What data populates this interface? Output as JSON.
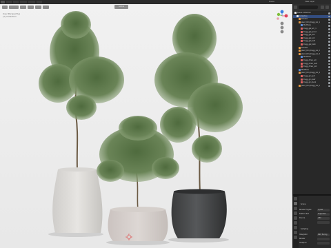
{
  "menu": {
    "items": [
      "",
      "",
      "",
      "",
      "",
      ""
    ]
  },
  "topbar": {
    "scene_label": "Scene",
    "view_layer_label": "View Layer"
  },
  "viewport": {
    "header": {
      "orientation_label": "Global"
    },
    "info_lines": [
      "User Perspective",
      "(1) Collection"
    ]
  },
  "outliner": {
    "rows": [
      {
        "label": "Scene Collection",
        "indent": 0,
        "icon": "collection-icon",
        "selected": false
      },
      {
        "label": "Collection",
        "indent": 1,
        "icon": "collection-icon",
        "selected": true
      },
      {
        "label": "Pot.001",
        "indent": 2,
        "icon": "mesh-icon",
        "selected": false
      },
      {
        "label": "plant_001_Dugg_sm_1",
        "indent": 2,
        "icon": "mesh-icon",
        "selected": false
      },
      {
        "label": "Modifiers",
        "indent": 3,
        "icon": "wrench-icon",
        "selected": false
      },
      {
        "label": "Dugg_gal_sm_1",
        "indent": 3,
        "icon": "material-icon",
        "selected": false
      },
      {
        "label": "Dugg_gal_wood",
        "indent": 3,
        "icon": "material-icon",
        "selected": false
      },
      {
        "label": "Dugg_gal_soil",
        "indent": 3,
        "icon": "material-icon",
        "selected": false
      },
      {
        "label": "Dugg_gal_pot",
        "indent": 3,
        "icon": "material-icon",
        "selected": false
      },
      {
        "label": "Dugg_gal_leaf",
        "indent": 3,
        "icon": "material-icon",
        "selected": false
      },
      {
        "label": "Dugg_gal_bark",
        "indent": 3,
        "icon": "material-icon",
        "selected": false
      },
      {
        "label": "Pot.002",
        "indent": 2,
        "icon": "mesh-icon",
        "selected": false
      },
      {
        "label": "plant_001_Dugg_sm_2",
        "indent": 2,
        "icon": "mesh-icon",
        "selected": false
      },
      {
        "label": "plant_001_Dugg_sm_3",
        "indent": 2,
        "icon": "mesh-icon",
        "selected": false
      },
      {
        "label": "Modifiers",
        "indent": 3,
        "icon": "wrench-icon",
        "selected": false
      },
      {
        "label": "Dugg_dmsn_sm",
        "indent": 3,
        "icon": "material-icon",
        "selected": false
      },
      {
        "label": "Dugg_dmsn_leaf",
        "indent": 3,
        "icon": "material-icon",
        "selected": false
      },
      {
        "label": "Dugg_dmsn_pot",
        "indent": 3,
        "icon": "material-icon",
        "selected": false
      },
      {
        "label": "Modifiers",
        "indent": 2,
        "icon": "wrench-icon",
        "selected": false
      },
      {
        "label": "plant_001_Dugg_sm_4",
        "indent": 2,
        "icon": "mesh-icon",
        "selected": false
      },
      {
        "label": "Dugg_grn_pot",
        "indent": 3,
        "icon": "material-icon",
        "selected": false
      },
      {
        "label": "Dugg_grn_leaf",
        "indent": 3,
        "icon": "material-icon",
        "selected": false
      },
      {
        "label": "Dugg_grn_bark",
        "indent": 3,
        "icon": "material-icon",
        "selected": false
      },
      {
        "label": "plant_001_Dugg_sm_5",
        "indent": 2,
        "icon": "mesh-icon",
        "selected": false
      }
    ]
  },
  "properties": {
    "section_title": "Scene",
    "rows": [
      {
        "label": "Render Engine",
        "value": "Cycles"
      },
      {
        "label": "Feature Set",
        "value": "Supported"
      },
      {
        "label": "Device",
        "value": "GPU"
      },
      {
        "label": "",
        "value": ""
      }
    ],
    "sampling_label": "Sampling",
    "bottom_rows": [
      {
        "label": "Integrator",
        "value": "Path Tracing"
      },
      {
        "label": "Render",
        "value": ""
      },
      {
        "label": "Viewport",
        "value": ""
      }
    ]
  },
  "colors": {
    "accent_selected": "#334d80",
    "collection_icon": "#e8e8e8",
    "mesh_icon": "#e59740",
    "material_icon": "#e06060",
    "wrench_icon": "#5a8ad6",
    "gizmo_x": "#e0405a",
    "gizmo_y": "#7fbf3a",
    "gizmo_z": "#3a7fe0"
  }
}
